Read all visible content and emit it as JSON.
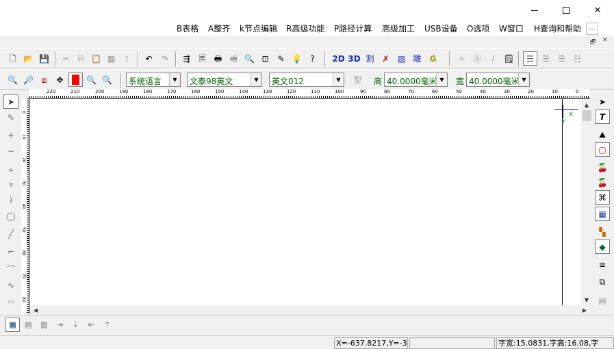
{
  "window": {
    "minimize_icon": "minimize-icon",
    "maximize_icon": "maximize-icon",
    "close_symbol": "✕"
  },
  "menu": {
    "items": [
      "B表格",
      "A整齐",
      "k节点编辑",
      "R高级功能",
      "P路径计算",
      "高级加工",
      "USB设备",
      "O选项",
      "W窗口",
      "H查询和帮助"
    ],
    "more": "…"
  },
  "mdi": {
    "restore": "🗗",
    "close": "✕"
  },
  "toolbar1": {
    "btn_2d": "2D",
    "btn_3d": "3D",
    "btn_cut": "割",
    "btn_carve": "雕",
    "btn_g": "G"
  },
  "toolbar2": {
    "lang_combo": "系统语言",
    "font_combo": "文泰98英文",
    "style_combo": "英文012",
    "type_label": "型",
    "height_label": "高",
    "height_value": "40.0000毫米",
    "width_label": "宽",
    "width_value": "40.0000毫米"
  },
  "ruler": {
    "h_ticks": [
      "220",
      "210",
      "200",
      "190",
      "180",
      "170",
      "160",
      "150",
      "140",
      "130",
      "120",
      "110",
      "100",
      "90",
      "80",
      "70",
      "60",
      "50",
      "40",
      "30",
      "20",
      "10",
      "0"
    ],
    "v_ticks": [
      "0",
      "10",
      "20",
      "30",
      "40",
      "50",
      "60",
      "70",
      "80"
    ]
  },
  "canvas": {
    "origin_x_label": "X",
    "origin_y_label": "Y"
  },
  "status": {
    "coords": "X=-637.8217,Y=-3",
    "middle": "",
    "char_info": "字宽:15.0831,字高:16.08,字"
  },
  "colors": {
    "accent_green": "#006000",
    "origin_blue": "#0000aa",
    "ruler_line": "#000000"
  }
}
